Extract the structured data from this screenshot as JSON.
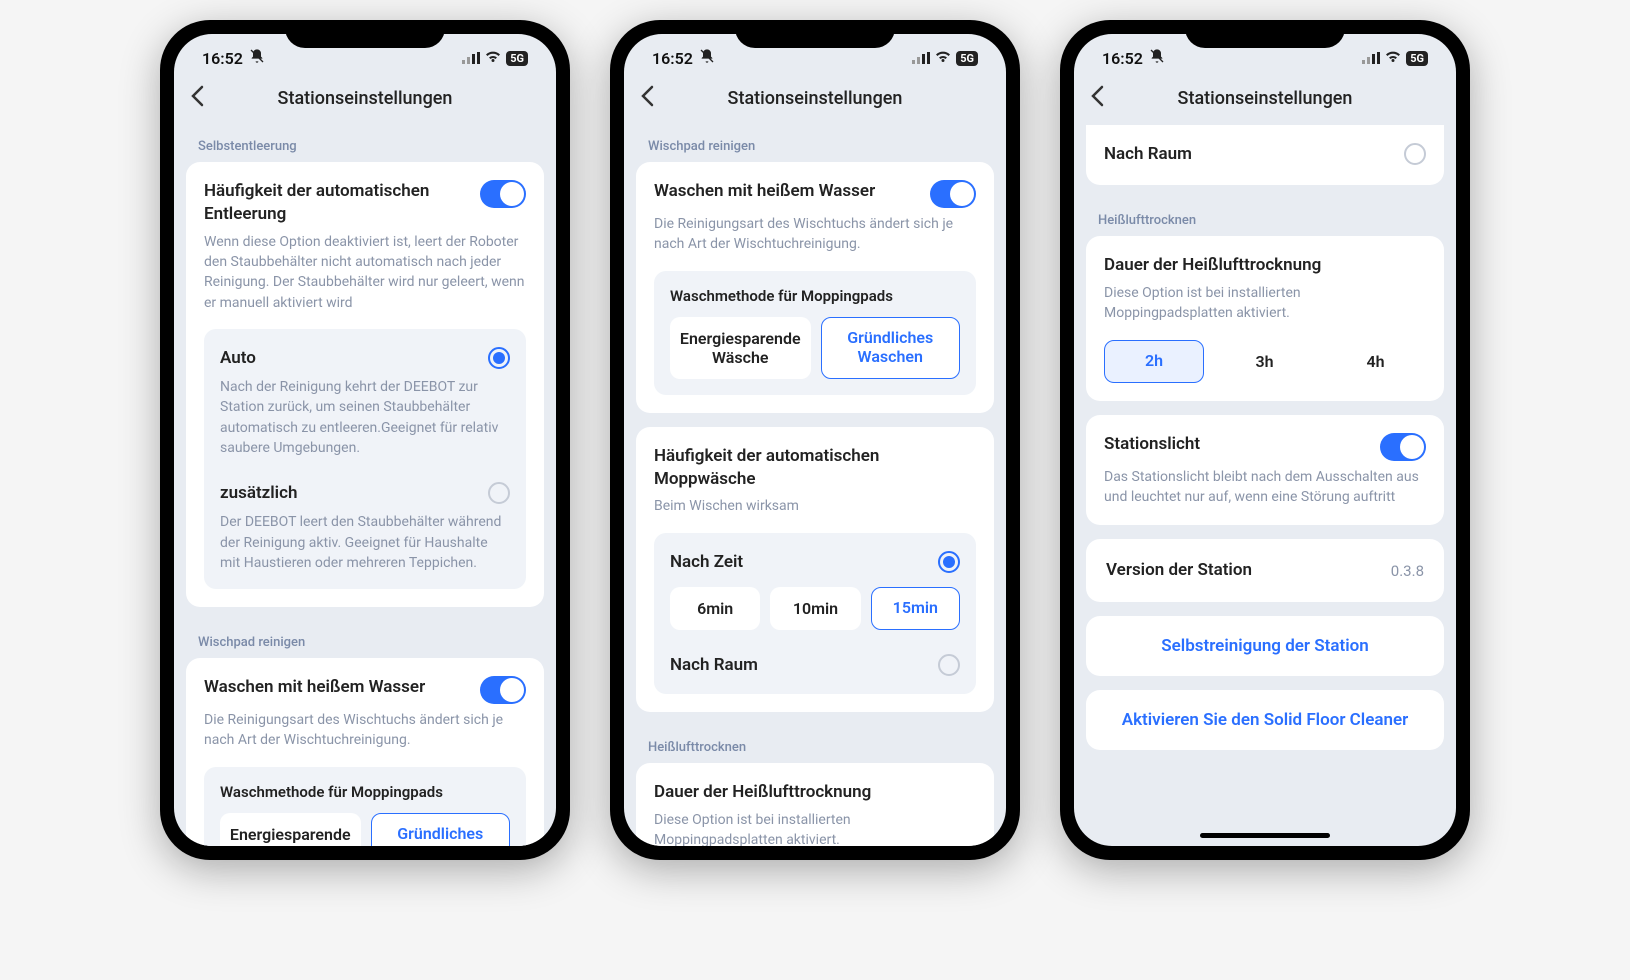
{
  "status": {
    "time": "16:52",
    "bell_muted": true,
    "network": "5G"
  },
  "header": {
    "title": "Stationseinstellungen"
  },
  "p1": {
    "section_self_empty": "Selbstentleerung",
    "freq_title": "Häufigkeit der automatischen Entleerung",
    "freq_toggle_on": true,
    "freq_desc": "Wenn diese Option deaktiviert ist, leert der Roboter den Staubbehälter nicht automatisch nach jeder Reinigung. Der Staubbehälter wird nur geleert, wenn er manuell aktiviert wird",
    "auto_title": "Auto",
    "auto_selected": true,
    "auto_desc": "Nach der Reinigung kehrt der DEEBOT zur Station zurück, um seinen Staubbehälter automatisch zu entleeren.Geeignet für relativ saubere Umgebungen.",
    "extra_title": "zusätzlich",
    "extra_selected": false,
    "extra_desc": "Der DEEBOT leert den Staubbehälter während der Reinigung aktiv. Geeignet für Haushalte mit Haustieren oder mehreren Teppichen.",
    "section_mop": "Wischpad reinigen",
    "hot_title": "Waschen mit heißem Wasser",
    "hot_toggle_on": true,
    "hot_desc": "Die Reinigungsart des Wischtuchs ändert sich je nach Art der Wischtuchreinigung.",
    "wash_method_label": "Waschmethode für Moppingpads",
    "wash_opt1": "Energiesparende",
    "wash_opt2": "Gründliches"
  },
  "p2": {
    "section_mop": "Wischpad reinigen",
    "hot_title": "Waschen mit heißem Wasser",
    "hot_toggle_on": true,
    "hot_desc": "Die Reinigungsart des Wischtuchs ändert sich je nach Art der Wischtuchreinigung.",
    "wash_method_label": "Waschmethode für Moppingpads",
    "wash_opt1": "Energiesparende Wäsche",
    "wash_opt2": "Gründliches Waschen",
    "wash_selected": 2,
    "mop_freq_title": "Häufigkeit der automatischen Moppwäsche",
    "mop_freq_desc": "Beim Wischen wirksam",
    "by_time_label": "Nach Zeit",
    "by_time_selected": true,
    "time_opts": [
      "6min",
      "10min",
      "15min"
    ],
    "time_selected": 2,
    "by_room_label": "Nach Raum",
    "by_room_selected": false,
    "section_dry": "Heißlufttrocknen",
    "dry_title": "Dauer der Heißlufttrocknung",
    "dry_desc": "Diese Option ist bei installierten Moppingpadsplatten aktiviert."
  },
  "p3": {
    "by_room_label": "Nach Raum",
    "by_room_selected": false,
    "section_dry": "Heißlufttrocknen",
    "dry_title": "Dauer der Heißlufttrocknung",
    "dry_desc": "Diese Option ist bei installierten Moppingpadsplatten aktiviert.",
    "dry_opts": [
      "2h",
      "3h",
      "4h"
    ],
    "dry_selected": 0,
    "light_title": "Stationslicht",
    "light_toggle_on": true,
    "light_desc": "Das Stationslicht bleibt nach dem Ausschalten aus und leuchtet nur auf, wenn eine Störung auftritt",
    "version_label": "Version der Station",
    "version_value": "0.3.8",
    "self_clean": "Selbstreinigung der Station",
    "activate_solid": "Aktivieren Sie den Solid Floor Cleaner"
  }
}
